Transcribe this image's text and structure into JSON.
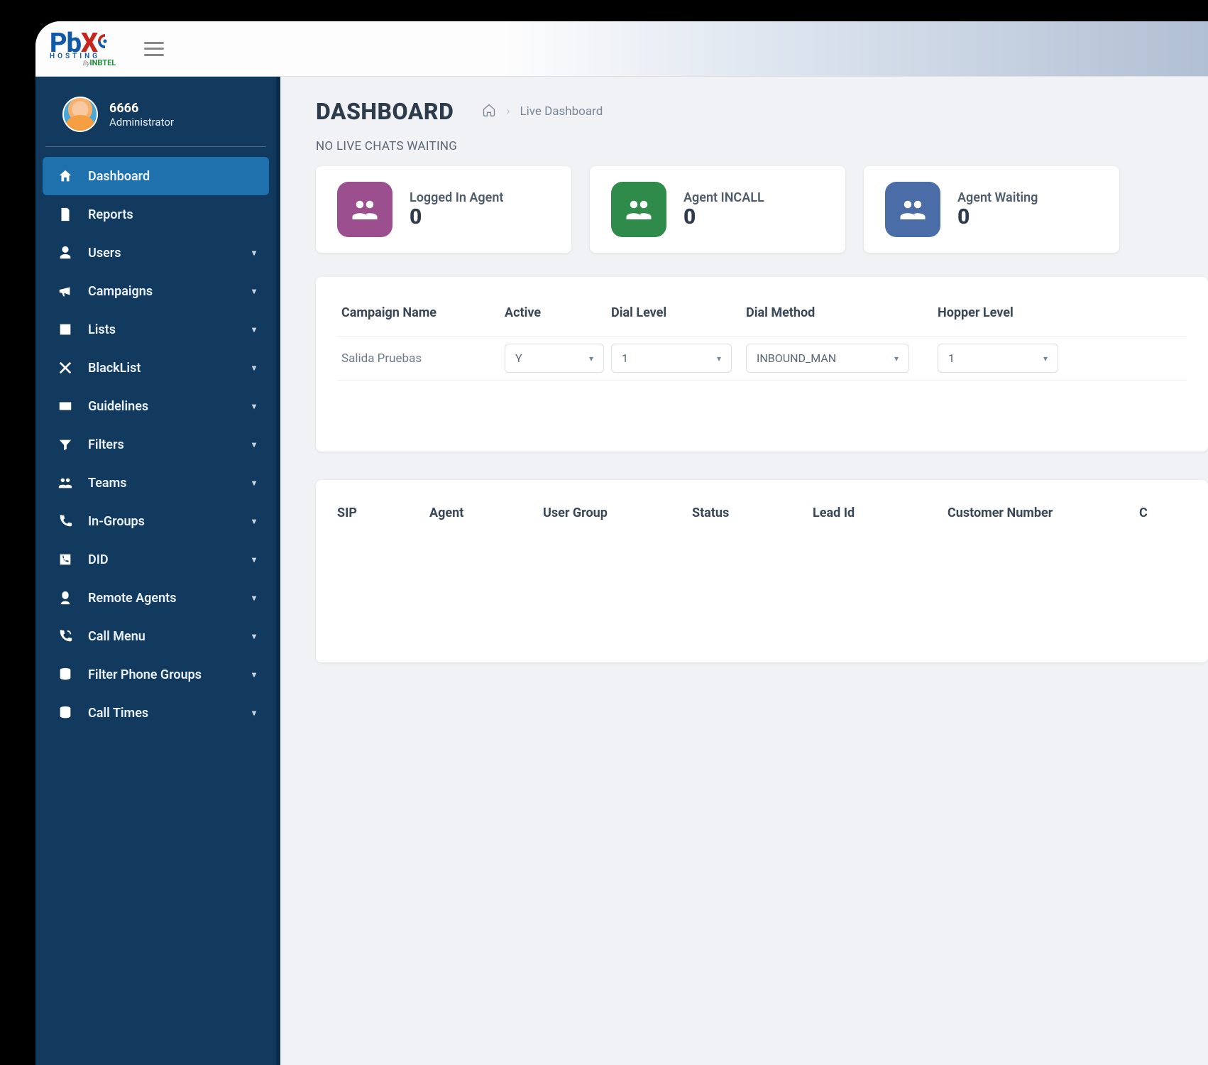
{
  "brand": {
    "p": "Pb",
    "x": "X",
    "hosting": "HOSTING",
    "by": "By",
    "inbtel": "INBTEL"
  },
  "user": {
    "id": "6666",
    "role": "Administrator"
  },
  "sidebar": {
    "items": [
      {
        "label": "Dashboard",
        "expandable": false,
        "active": true
      },
      {
        "label": "Reports",
        "expandable": false
      },
      {
        "label": "Users",
        "expandable": true
      },
      {
        "label": "Campaigns",
        "expandable": true
      },
      {
        "label": "Lists",
        "expandable": true
      },
      {
        "label": "BlackList",
        "expandable": true
      },
      {
        "label": "Guidelines",
        "expandable": true
      },
      {
        "label": "Filters",
        "expandable": true
      },
      {
        "label": "Teams",
        "expandable": true
      },
      {
        "label": "In-Groups",
        "expandable": true
      },
      {
        "label": "DID",
        "expandable": true
      },
      {
        "label": "Remote Agents",
        "expandable": true
      },
      {
        "label": "Call Menu",
        "expandable": true
      },
      {
        "label": "Filter Phone Groups",
        "expandable": true
      },
      {
        "label": "Call Times",
        "expandable": true
      }
    ]
  },
  "page": {
    "title": "DASHBOARD",
    "breadcrumb": "Live Dashboard",
    "status": "NO LIVE CHATS WAITING"
  },
  "cards": [
    {
      "label": "Logged In Agent",
      "value": "0",
      "color": "#9b4f8f"
    },
    {
      "label": "Agent INCALL",
      "value": "0",
      "color": "#2e8b4a"
    },
    {
      "label": "Agent Waiting",
      "value": "0",
      "color": "#4a6da7"
    }
  ],
  "campaign_table": {
    "headers": [
      "Campaign Name",
      "Active",
      "Dial Level",
      "Dial Method",
      "Hopper Level"
    ],
    "row": {
      "name": "Salida Pruebas",
      "active": "Y",
      "dial_level": "1",
      "dial_method": "INBOUND_MAN",
      "hopper_level": "1"
    }
  },
  "agent_table": {
    "headers": [
      "SIP",
      "Agent",
      "User Group",
      "Status",
      "Lead Id",
      "Customer Number",
      "C"
    ]
  }
}
